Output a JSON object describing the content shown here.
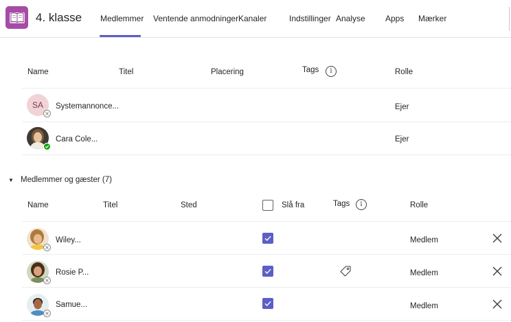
{
  "team": {
    "title": "4. klasse",
    "icon": "book-icon",
    "icon_color": "#a64ca6"
  },
  "tabs": [
    {
      "label": "Medlemmer",
      "active": true
    },
    {
      "label": "Ventende anmodninger",
      "active": false
    },
    {
      "label": "Kanaler",
      "active": false
    },
    {
      "label": "Indstillinger",
      "active": false
    },
    {
      "label": "Analyse",
      "active": false
    },
    {
      "label": "Apps",
      "active": false
    },
    {
      "label": "Mærker",
      "active": false
    }
  ],
  "owners_table": {
    "headers": {
      "name": "Name",
      "title": "Titel",
      "location": "Placering",
      "tags": "Tags",
      "role": "Rolle"
    },
    "rows": [
      {
        "initials": "SA",
        "name": "Systemannonce...",
        "role": "Ejer",
        "status": "offline"
      },
      {
        "initials": "",
        "name": "Cara Cole...",
        "role": "Ejer",
        "status": "available"
      }
    ]
  },
  "members_section": {
    "label": "Medlemmer og gæster (7)",
    "expanded": true,
    "headers": {
      "name": "Name",
      "title": "Titel",
      "location": "Sted",
      "mute": "Slå fra",
      "tags": "Tags",
      "role": "Rolle"
    },
    "rows": [
      {
        "name": "Wiley...",
        "muted": true,
        "role": "Medlem",
        "has_tag_icon": false,
        "status": "offline"
      },
      {
        "name": "Rosie P...",
        "muted": true,
        "role": "Medlem",
        "has_tag_icon": true,
        "status": "offline"
      },
      {
        "name": "Samue...",
        "muted": true,
        "role": "Medlem",
        "has_tag_icon": false,
        "status": "offline"
      }
    ]
  },
  "colors": {
    "accent": "#5b5fc7",
    "available": "#13a10e"
  }
}
